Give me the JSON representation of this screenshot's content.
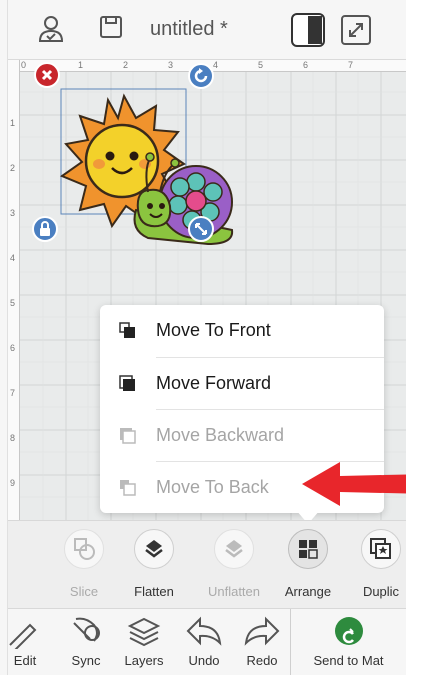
{
  "header": {
    "title": "untitled *"
  },
  "ruler": {
    "top": [
      "0",
      "1",
      "2",
      "3",
      "4",
      "5",
      "6",
      "7"
    ],
    "left": [
      "1",
      "2",
      "3",
      "4",
      "5",
      "6",
      "7",
      "8",
      "9"
    ]
  },
  "arrange_menu": {
    "items": [
      {
        "label": "Move To Front",
        "enabled": true
      },
      {
        "label": "Move Forward",
        "enabled": true
      },
      {
        "label": "Move Backward",
        "enabled": false
      },
      {
        "label": "Move To Back",
        "enabled": false
      }
    ]
  },
  "toolstrip": {
    "items": [
      {
        "label": "Slice",
        "enabled": false,
        "icon": "slice-icon"
      },
      {
        "label": "Flatten",
        "enabled": true,
        "icon": "flatten-icon"
      },
      {
        "label": "Unflatten",
        "enabled": false,
        "icon": "unflatten-icon"
      },
      {
        "label": "Arrange",
        "enabled": true,
        "selected": true,
        "icon": "arrange-icon"
      },
      {
        "label": "Duplic",
        "enabled": true,
        "icon": "duplicate-icon"
      }
    ]
  },
  "bottom_nav": {
    "items": [
      {
        "label": "Edit",
        "icon": "edit-icon"
      },
      {
        "label": "Sync",
        "icon": "sync-icon"
      },
      {
        "label": "Layers",
        "icon": "layers-icon"
      },
      {
        "label": "Undo",
        "icon": "undo-icon"
      },
      {
        "label": "Redo",
        "icon": "redo-icon"
      },
      {
        "label": "Send to Mat",
        "icon": "send-to-mat-icon"
      }
    ]
  },
  "colors": {
    "accent_green": "#2e8b3e",
    "handle_blue": "#4a7fc1",
    "handle_red": "#c8262c",
    "arrow_red": "#e8262b"
  }
}
